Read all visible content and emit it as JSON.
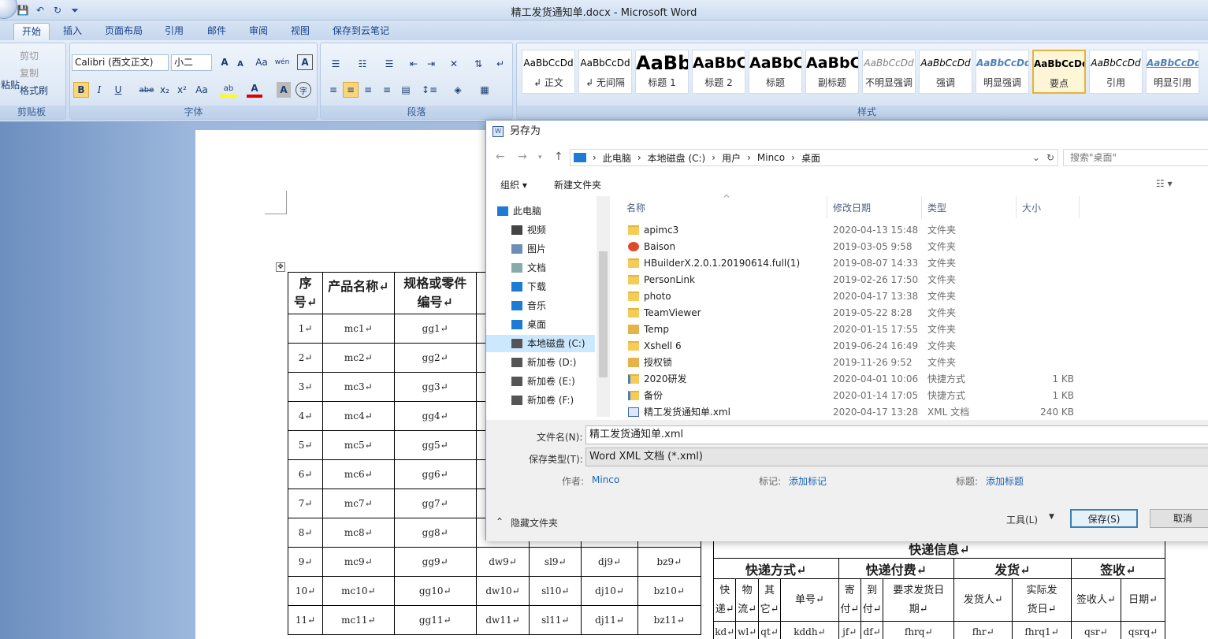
{
  "window": {
    "title": "精工发货通知单.docx - Microsoft Word"
  },
  "qat": {
    "save": "💾",
    "undo": "↶",
    "redo": "↻",
    "more": "⏷"
  },
  "tabs": [
    "开始",
    "插入",
    "页面布局",
    "引用",
    "邮件",
    "审阅",
    "视图",
    "保存到云笔记"
  ],
  "ribbon": {
    "clipboard": {
      "label": "剪贴板",
      "paste": "粘贴",
      "cut": "剪切",
      "copy": "复制",
      "format_painter": "格式刷"
    },
    "font": {
      "label": "字体",
      "font_name": "Calibri (西文正文)",
      "font_size": "小二",
      "grow": "A",
      "shrink": "A",
      "clear": "Aa",
      "wen": "wén",
      "border_a": "A",
      "bold": "B",
      "italic": "I",
      "underline": "U",
      "strike": "abe",
      "sub": "x₂",
      "sup": "x²",
      "case": "Aa",
      "highlight": "ab",
      "color": "A",
      "shade": "A",
      "enclose": "字"
    },
    "paragraph": {
      "label": "段落"
    },
    "styles": {
      "label": "样式",
      "items": [
        {
          "sample": "AaBbCcDd",
          "name": "↲ 正文"
        },
        {
          "sample": "AaBbCcDd",
          "name": "↲ 无间隔"
        },
        {
          "sample": "AaBb",
          "name": "标题 1"
        },
        {
          "sample": "AaBbC",
          "name": "标题 2"
        },
        {
          "sample": "AaBbC",
          "name": "标题"
        },
        {
          "sample": "AaBbC",
          "name": "副标题"
        },
        {
          "sample": "AaBbCcDd",
          "name": "不明显强调"
        },
        {
          "sample": "AaBbCcDd",
          "name": "强调"
        },
        {
          "sample": "AaBbCcDd",
          "name": "明显强调"
        },
        {
          "sample": "AaBbCcDd",
          "name": "要点"
        },
        {
          "sample": "AaBbCcDd",
          "name": "引用"
        },
        {
          "sample": "AaBbCcDd",
          "name": "明显引用"
        }
      ]
    }
  },
  "doc_table": {
    "headers": [
      "序\n号↵",
      "产品名称↵",
      "规格或零件\n编号↵"
    ],
    "rows": [
      [
        "1↵",
        "mc1↵",
        "gg1↵"
      ],
      [
        "2↵",
        "mc2↵",
        "gg2↵"
      ],
      [
        "3↵",
        "mc3↵",
        "gg3↵"
      ],
      [
        "4↵",
        "mc4↵",
        "gg4↵"
      ],
      [
        "5↵",
        "mc5↵",
        "gg5↵"
      ],
      [
        "6↵",
        "mc6↵",
        "gg6↵"
      ],
      [
        "7↵",
        "mc7↵",
        "gg7↵"
      ],
      [
        "8↵",
        "mc8↵",
        "gg8↵"
      ],
      [
        "9↵",
        "mc9↵",
        "gg9↵",
        "dw9↵",
        "sl9↵",
        "dj9↵",
        "bz9↵"
      ],
      [
        "10↵",
        "mc10↵",
        "gg10↵",
        "dw10↵",
        "sl10↵",
        "dj10↵",
        "bz10↵"
      ],
      [
        "11↵",
        "mc11↵",
        "gg11↵",
        "dw11↵",
        "sl11↵",
        "dj11↵",
        "bz11↵"
      ]
    ]
  },
  "express_table": {
    "title": "快递信息↵",
    "groups": [
      "快递方式↵",
      "快递付费↵",
      "发货↵",
      "签收↵"
    ],
    "subheaders": [
      "快\n递↵",
      "物\n流↵",
      "其\n它↵",
      "单号↵",
      "寄\n付↵",
      "到\n付↵",
      "要求发货日\n期↵",
      "发货人↵",
      "实际发\n货日↵",
      "签收人↵",
      "日期↵"
    ],
    "row": [
      "kd↵",
      "wl↵",
      "qt↵",
      "kddh↵",
      "jf↵",
      "df↵",
      "fhrq↵",
      "fhr↵",
      "fhrq1↵",
      "qsr↵",
      "qsrq↵"
    ]
  },
  "dialog": {
    "title": "另存为",
    "breadcrumb": [
      "此电脑",
      "本地磁盘 (C:)",
      "用户",
      "Minco",
      "桌面"
    ],
    "search_placeholder": "搜索\"桌面\"",
    "toolbar": {
      "organize": "组织 ▾",
      "new_folder": "新建文件夹"
    },
    "nav": [
      "此电脑",
      "视频",
      "图片",
      "文档",
      "下载",
      "音乐",
      "桌面",
      "本地磁盘 (C:)",
      "新加卷 (D:)",
      "新加卷 (E:)",
      "新加卷 (F:)"
    ],
    "columns": {
      "name": "名称",
      "date": "修改日期",
      "type": "类型",
      "size": "大小"
    },
    "files": [
      {
        "name": "apimc3",
        "date": "2020-04-13 15:48",
        "type": "文件夹",
        "size": "",
        "icon": "folder-icon"
      },
      {
        "name": "Baison",
        "date": "2019-03-05 9:58",
        "type": "文件夹",
        "size": "",
        "icon": "baison-icon"
      },
      {
        "name": "HBuilderX.2.0.1.20190614.full(1)",
        "date": "2019-08-07 14:33",
        "type": "文件夹",
        "size": "",
        "icon": "folder-icon"
      },
      {
        "name": "PersonLink",
        "date": "2019-02-26 17:50",
        "type": "文件夹",
        "size": "",
        "icon": "folder-icon"
      },
      {
        "name": "photo",
        "date": "2020-04-17 13:38",
        "type": "文件夹",
        "size": "",
        "icon": "folder-icon"
      },
      {
        "name": "TeamViewer",
        "date": "2019-05-22 8:28",
        "type": "文件夹",
        "size": "",
        "icon": "folder-icon"
      },
      {
        "name": "Temp",
        "date": "2020-01-15 17:55",
        "type": "文件夹",
        "size": "",
        "icon": "lock-folder-icon"
      },
      {
        "name": "Xshell 6",
        "date": "2019-06-24 16:49",
        "type": "文件夹",
        "size": "",
        "icon": "folder-icon"
      },
      {
        "name": "授权锁",
        "date": "2019-11-26 9:52",
        "type": "文件夹",
        "size": "",
        "icon": "lock-folder-icon"
      },
      {
        "name": "2020研发",
        "date": "2020-04-01 10:06",
        "type": "快捷方式",
        "size": "1 KB",
        "icon": "shortcut-icon"
      },
      {
        "name": "备份",
        "date": "2020-01-14 17:05",
        "type": "快捷方式",
        "size": "1 KB",
        "icon": "shortcut-icon"
      },
      {
        "name": "精工发货通知单.xml",
        "date": "2020-04-17 13:28",
        "type": "XML 文档",
        "size": "240 KB",
        "icon": "xml-file-icon"
      }
    ],
    "filename_label": "文件名(N):",
    "filename": "精工发货通知单.xml",
    "filetype_label": "保存类型(T):",
    "filetype": "Word XML 文档 (*.xml)",
    "author_label": "作者:",
    "author": "Minco",
    "tags_label": "标记:",
    "tags": "添加标记",
    "title_label": "标题:",
    "title_value": "添加标题",
    "hide_folders": "隐藏文件夹",
    "tools": "工具(L)",
    "save": "保存(S)",
    "cancel": "取消"
  },
  "colors": {
    "accent": "#15428b",
    "link": "#1e64b4",
    "selection": "#cce8ff"
  }
}
